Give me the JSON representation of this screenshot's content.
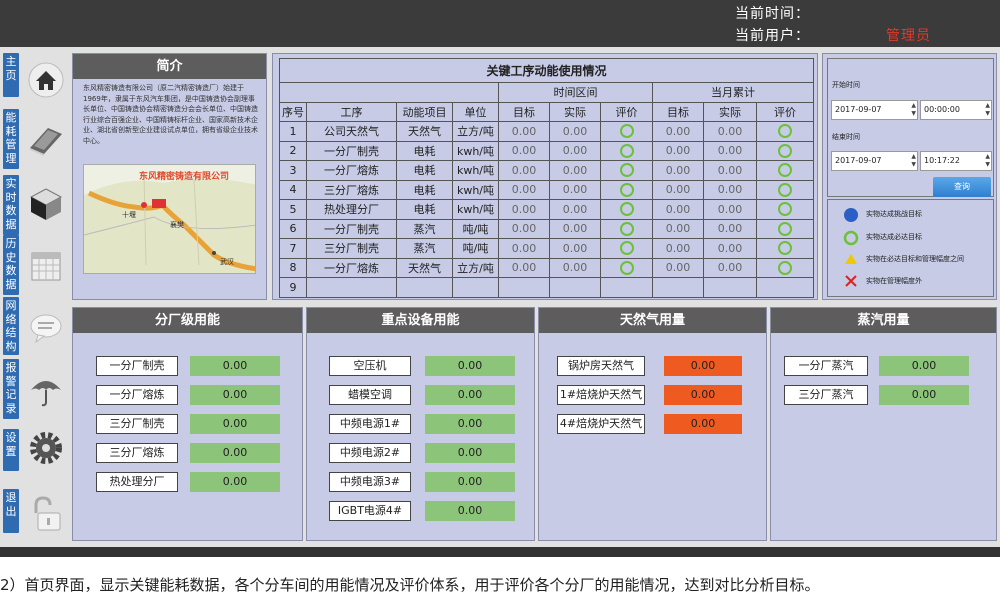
{
  "header": {
    "current_time_label": "当前时间：",
    "current_user_label": "当前用户：",
    "role": "管理员"
  },
  "sidebar": {
    "items": [
      {
        "label": "主页",
        "icon": "home-icon"
      },
      {
        "label": "能耗管理",
        "icon": "book-icon"
      },
      {
        "label": "实时数据",
        "icon": "cube-icon"
      },
      {
        "label": "历史数据",
        "icon": "calendar-icon"
      },
      {
        "label": "网络结构",
        "icon": "chat-bubble-icon"
      },
      {
        "label": "报警记录",
        "icon": "umbrella-icon"
      },
      {
        "label": "设置",
        "icon": "gear-icon"
      },
      {
        "label": "退出",
        "icon": "unlock-icon"
      }
    ]
  },
  "intro": {
    "title": "简介",
    "text": "东风精密铸造有限公司（原二汽精密铸造厂）始建于1969年，隶属于东风汽车集团，是中国铸造协会副理事长单位、中国铸造协会精密铸造分会会长单位、中国铸造行业综合百强企业、中国精铸标杆企业、国家高新技术企业、湖北省创新型企业建设试点单位，拥有省级企业技术中心。",
    "map_title": "东风精密铸造有限公司",
    "map_labels": [
      "十堰",
      "襄樊",
      "武汉"
    ]
  },
  "key_table": {
    "title": "关键工序动能使用情况",
    "group_headers": [
      "时间区间",
      "当月累计"
    ],
    "columns": [
      "序号",
      "工序",
      "动能项目",
      "单位",
      "目标",
      "实际",
      "评价",
      "目标",
      "实际",
      "评价"
    ],
    "rows": [
      {
        "no": "1",
        "process": "公司天然气",
        "item": "天然气",
        "unit": "立方/吨",
        "t1": "0.00",
        "a1": "0.00",
        "t2": "0.00",
        "a2": "0.00",
        "eval1": "ring",
        "eval2": "ring"
      },
      {
        "no": "2",
        "process": "一分厂制壳",
        "item": "电耗",
        "unit": "kwh/吨",
        "t1": "0.00",
        "a1": "0.00",
        "t2": "0.00",
        "a2": "0.00",
        "eval1": "ring",
        "eval2": "ring"
      },
      {
        "no": "3",
        "process": "一分厂熔炼",
        "item": "电耗",
        "unit": "kwh/吨",
        "t1": "0.00",
        "a1": "0.00",
        "t2": "0.00",
        "a2": "0.00",
        "eval1": "ring",
        "eval2": "ring"
      },
      {
        "no": "4",
        "process": "三分厂熔炼",
        "item": "电耗",
        "unit": "kwh/吨",
        "t1": "0.00",
        "a1": "0.00",
        "t2": "0.00",
        "a2": "0.00",
        "eval1": "ring",
        "eval2": "ring"
      },
      {
        "no": "5",
        "process": "热处理分厂",
        "item": "电耗",
        "unit": "kwh/吨",
        "t1": "0.00",
        "a1": "0.00",
        "t2": "0.00",
        "a2": "0.00",
        "eval1": "ring",
        "eval2": "ring"
      },
      {
        "no": "6",
        "process": "一分厂制壳",
        "item": "蒸汽",
        "unit": "吨/吨",
        "t1": "0.00",
        "a1": "0.00",
        "t2": "0.00",
        "a2": "0.00",
        "eval1": "ring",
        "eval2": "ring"
      },
      {
        "no": "7",
        "process": "三分厂制壳",
        "item": "蒸汽",
        "unit": "吨/吨",
        "t1": "0.00",
        "a1": "0.00",
        "t2": "0.00",
        "a2": "0.00",
        "eval1": "ring",
        "eval2": "ring"
      },
      {
        "no": "8",
        "process": "一分厂熔炼",
        "item": "天然气",
        "unit": "立方/吨",
        "t1": "0.00",
        "a1": "0.00",
        "t2": "0.00",
        "a2": "0.00",
        "eval1": "ring",
        "eval2": "ring"
      },
      {
        "no": "9",
        "process": "",
        "item": "",
        "unit": "",
        "t1": "",
        "a1": "",
        "t2": "",
        "a2": "",
        "eval1": "",
        "eval2": ""
      }
    ]
  },
  "filter": {
    "start_label": "开始时间",
    "start_date": "2017-09-07",
    "start_time": "00:00:00",
    "end_label": "结束时间",
    "end_date": "2017-09-07",
    "end_time": "10:17:22",
    "query_button": "查询"
  },
  "legend": {
    "items": [
      {
        "icon": "blue-dot-icon",
        "text": "实物达成挑战目标",
        "color": "#2b5fc4"
      },
      {
        "icon": "green-ring-icon",
        "text": "实物达成必达目标",
        "color": "#6cc03a"
      },
      {
        "icon": "yellow-triangle-icon",
        "text": "实物在必达目标和管理幅度之间",
        "color": "#f0c800"
      },
      {
        "icon": "red-x-icon",
        "text": "实物在管理幅度外",
        "color": "#e02020"
      }
    ]
  },
  "branch_energy": {
    "title": "分厂级用能",
    "items": [
      {
        "label": "一分厂制壳",
        "value": "0.00"
      },
      {
        "label": "一分厂熔炼",
        "value": "0.00"
      },
      {
        "label": "三分厂制壳",
        "value": "0.00"
      },
      {
        "label": "三分厂熔炼",
        "value": "0.00"
      },
      {
        "label": "热处理分厂",
        "value": "0.00"
      }
    ]
  },
  "equipment_energy": {
    "title": "重点设备用能",
    "items": [
      {
        "label": "空压机",
        "value": "0.00"
      },
      {
        "label": "蜡模空调",
        "value": "0.00"
      },
      {
        "label": "中频电源1#",
        "value": "0.00"
      },
      {
        "label": "中频电源2#",
        "value": "0.00"
      },
      {
        "label": "中频电源3#",
        "value": "0.00"
      },
      {
        "label": "IGBT电源4#",
        "value": "0.00"
      }
    ]
  },
  "gas_usage": {
    "title": "天然气用量",
    "items": [
      {
        "label": "锅炉房天然气",
        "value": "0.00"
      },
      {
        "label": "1#焙烧炉天然气",
        "value": "0.00"
      },
      {
        "label": "4#焙烧炉天然气",
        "value": "0.00"
      }
    ]
  },
  "steam_usage": {
    "title": "蒸汽用量",
    "items": [
      {
        "label": "一分厂蒸汽",
        "value": "0.00"
      },
      {
        "label": "三分厂蒸汽",
        "value": "0.00"
      }
    ]
  },
  "caption": "2）首页界面，显示关键能耗数据，各个分车间的用能情况及评价体系，用于评价各个分厂的用能情况，达到对比分析目标。"
}
